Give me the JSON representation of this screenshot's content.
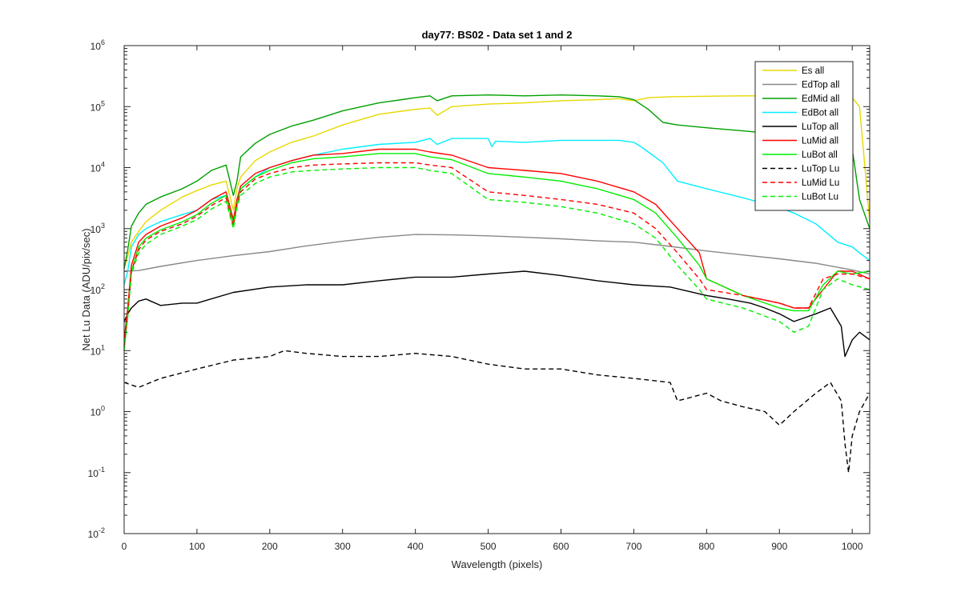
{
  "chart_data": {
    "type": "line",
    "title": "day77: BS02 - Data set 1 and 2",
    "xlabel": "Wavelength (pixels)",
    "ylabel": "Net Lu Data (ADU/pix/sec)",
    "xlim": [
      0,
      1024
    ],
    "ylim": [
      0.01,
      1000000
    ],
    "yscale": "log",
    "grid": false,
    "legend_position": "top-right",
    "x_ticks": [
      0,
      100,
      200,
      300,
      400,
      500,
      600,
      700,
      800,
      900,
      1000
    ],
    "x_tick_labels": [
      "0",
      "100",
      "200",
      "300",
      "400",
      "500",
      "600",
      "700",
      "800",
      "900",
      "1000"
    ],
    "y_ticks": [
      {
        "value": 0.01,
        "base": "10",
        "exp": "-2"
      },
      {
        "value": 0.1,
        "base": "10",
        "exp": "-1"
      },
      {
        "value": 1,
        "base": "10",
        "exp": "0"
      },
      {
        "value": 10,
        "base": "10",
        "exp": "1"
      },
      {
        "value": 100,
        "base": "10",
        "exp": "2"
      },
      {
        "value": 1000,
        "base": "10",
        "exp": "3"
      },
      {
        "value": 10000,
        "base": "10",
        "exp": "4"
      },
      {
        "value": 100000,
        "base": "10",
        "exp": "5"
      },
      {
        "value": 1000000,
        "base": "10",
        "exp": "6"
      }
    ],
    "series": [
      {
        "name": "Es  all",
        "color": "#e8d800",
        "dash": "solid",
        "x": [
          0,
          5,
          10,
          20,
          30,
          50,
          80,
          100,
          120,
          140,
          150,
          155,
          160,
          180,
          200,
          230,
          260,
          300,
          350,
          400,
          420,
          430,
          450,
          500,
          550,
          600,
          650,
          680,
          700,
          720,
          750,
          800,
          850,
          900,
          950,
          980,
          1000,
          1010,
          1024
        ],
        "y": [
          220,
          350,
          600,
          900,
          1300,
          2000,
          3300,
          4200,
          5200,
          6000,
          2000,
          4500,
          7000,
          13000,
          18000,
          26000,
          33000,
          50000,
          75000,
          90000,
          95000,
          72000,
          100000,
          110000,
          115000,
          125000,
          130000,
          135000,
          125000,
          140000,
          145000,
          148000,
          150000,
          150000,
          150000,
          148000,
          140000,
          100000,
          1300
        ]
      },
      {
        "name": "EdTop  all",
        "color": "#888888",
        "dash": "solid",
        "x": [
          0,
          20,
          50,
          100,
          150,
          200,
          250,
          300,
          350,
          400,
          450,
          500,
          550,
          600,
          650,
          700,
          750,
          800,
          850,
          900,
          950,
          1000,
          1024
        ],
        "y": [
          200,
          205,
          240,
          300,
          360,
          420,
          520,
          620,
          720,
          800,
          790,
          760,
          720,
          680,
          630,
          600,
          510,
          430,
          370,
          320,
          270,
          210,
          180
        ]
      },
      {
        "name": "EdMid  all",
        "color": "#00a000",
        "dash": "solid",
        "x": [
          0,
          5,
          10,
          20,
          30,
          50,
          80,
          100,
          120,
          140,
          150,
          155,
          160,
          180,
          200,
          230,
          260,
          300,
          350,
          400,
          420,
          430,
          450,
          500,
          550,
          600,
          650,
          680,
          700,
          720,
          740,
          760,
          800,
          850,
          900,
          950,
          980,
          1000,
          1010,
          1024
        ],
        "y": [
          220,
          450,
          1100,
          1800,
          2500,
          3300,
          4500,
          6000,
          9000,
          11000,
          3500,
          6000,
          15000,
          25000,
          35000,
          48000,
          60000,
          85000,
          115000,
          140000,
          150000,
          125000,
          150000,
          155000,
          150000,
          155000,
          150000,
          145000,
          130000,
          90000,
          55000,
          50000,
          45000,
          40000,
          35000,
          30000,
          25000,
          20000,
          3000,
          1000
        ]
      },
      {
        "name": "EdBot  all",
        "color": "#00eeff",
        "dash": "solid",
        "x": [
          0,
          5,
          10,
          20,
          30,
          50,
          80,
          100,
          120,
          140,
          150,
          155,
          160,
          180,
          200,
          230,
          260,
          300,
          350,
          400,
          420,
          430,
          450,
          500,
          505,
          510,
          550,
          600,
          650,
          680,
          700,
          710,
          720,
          740,
          760,
          800,
          850,
          900,
          920,
          950,
          980,
          1000,
          1010,
          1024
        ],
        "y": [
          120,
          200,
          500,
          800,
          1000,
          1300,
          1700,
          2000,
          3000,
          3500,
          1300,
          2500,
          4500,
          7000,
          10000,
          13000,
          16000,
          20000,
          24000,
          26000,
          30000,
          24000,
          30000,
          30000,
          22000,
          27000,
          26000,
          28000,
          28000,
          28000,
          26000,
          22000,
          18000,
          12000,
          6000,
          4500,
          3200,
          2200,
          1800,
          1200,
          600,
          500,
          400,
          300
        ]
      },
      {
        "name": "LuTop  all",
        "color": "#000000",
        "dash": "solid",
        "x": [
          0,
          5,
          10,
          20,
          30,
          50,
          80,
          100,
          150,
          200,
          250,
          300,
          350,
          400,
          450,
          500,
          550,
          600,
          650,
          700,
          750,
          800,
          830,
          860,
          880,
          900,
          920,
          950,
          970,
          985,
          990,
          1000,
          1010,
          1024
        ],
        "y": [
          30,
          40,
          50,
          65,
          70,
          55,
          60,
          60,
          90,
          110,
          120,
          120,
          140,
          160,
          160,
          180,
          200,
          170,
          140,
          120,
          110,
          80,
          70,
          60,
          50,
          40,
          30,
          40,
          50,
          25,
          8,
          15,
          20,
          15
        ]
      },
      {
        "name": "LuMid  all",
        "color": "#ff0000",
        "dash": "solid",
        "x": [
          0,
          5,
          10,
          20,
          30,
          50,
          80,
          100,
          120,
          140,
          150,
          155,
          160,
          180,
          200,
          230,
          260,
          300,
          350,
          400,
          420,
          450,
          500,
          550,
          600,
          650,
          700,
          730,
          760,
          790,
          800,
          850,
          900,
          920,
          940,
          960,
          980,
          1000,
          1024
        ],
        "y": [
          15,
          50,
          250,
          600,
          800,
          1100,
          1500,
          2000,
          3000,
          4000,
          1400,
          3000,
          5000,
          8000,
          10000,
          13000,
          16000,
          17000,
          20000,
          20000,
          18000,
          16000,
          10000,
          9000,
          8000,
          6000,
          4000,
          2500,
          1000,
          400,
          150,
          80,
          60,
          50,
          50,
          100,
          200,
          200,
          150
        ]
      },
      {
        "name": "LuBot  all",
        "color": "#00ee00",
        "dash": "solid",
        "x": [
          0,
          5,
          10,
          20,
          30,
          50,
          80,
          100,
          120,
          140,
          150,
          155,
          160,
          180,
          200,
          230,
          260,
          300,
          350,
          400,
          420,
          450,
          500,
          550,
          600,
          650,
          700,
          730,
          760,
          790,
          800,
          850,
          900,
          920,
          940,
          960,
          980,
          1000,
          1024
        ],
        "y": [
          10,
          40,
          200,
          500,
          700,
          950,
          1300,
          1700,
          2600,
          3500,
          1200,
          2600,
          4500,
          7000,
          9000,
          12000,
          14000,
          15000,
          17000,
          17000,
          15000,
          13500,
          8000,
          7000,
          6000,
          4500,
          3000,
          1800,
          700,
          250,
          150,
          80,
          50,
          45,
          45,
          120,
          200,
          180,
          200
        ]
      },
      {
        "name": "LuTop  Lu",
        "color": "#000000",
        "dash": "dashed",
        "x": [
          0,
          20,
          50,
          100,
          150,
          200,
          220,
          250,
          300,
          350,
          400,
          450,
          500,
          550,
          600,
          650,
          700,
          750,
          760,
          800,
          820,
          850,
          880,
          900,
          920,
          950,
          970,
          985,
          990,
          995,
          1000,
          1010,
          1024
        ],
        "y": [
          3,
          2.5,
          3.5,
          5,
          7,
          8,
          10,
          9,
          8,
          8,
          9,
          8,
          6,
          5,
          5,
          4,
          3.5,
          3,
          1.5,
          2,
          1.5,
          1.2,
          1,
          0.6,
          1,
          2,
          3,
          1.5,
          0.3,
          0.1,
          0.4,
          1,
          2
        ]
      },
      {
        "name": "LuMid  Lu",
        "color": "#ff0000",
        "dash": "dashed",
        "x": [
          0,
          5,
          10,
          20,
          30,
          50,
          80,
          100,
          120,
          140,
          150,
          155,
          160,
          180,
          200,
          230,
          260,
          300,
          350,
          400,
          420,
          450,
          500,
          550,
          600,
          650,
          700,
          730,
          760,
          790,
          800,
          850,
          900,
          920,
          940,
          960,
          980,
          1000,
          1024
        ],
        "y": [
          12,
          40,
          200,
          450,
          650,
          900,
          1200,
          1600,
          2400,
          3200,
          1100,
          2500,
          4000,
          6500,
          8000,
          10000,
          11000,
          11500,
          12000,
          12000,
          11000,
          10000,
          4000,
          3500,
          3000,
          2500,
          1800,
          1000,
          400,
          150,
          100,
          80,
          60,
          50,
          50,
          150,
          180,
          180,
          150
        ]
      },
      {
        "name": "LuBot  Lu",
        "color": "#00ee00",
        "dash": "dashed",
        "x": [
          0,
          5,
          10,
          20,
          30,
          50,
          80,
          100,
          120,
          140,
          150,
          155,
          160,
          180,
          200,
          230,
          260,
          300,
          350,
          400,
          420,
          450,
          500,
          550,
          600,
          650,
          700,
          730,
          760,
          790,
          800,
          850,
          900,
          920,
          940,
          960,
          980,
          1000,
          1024
        ],
        "y": [
          10,
          35,
          180,
          400,
          550,
          800,
          1100,
          1400,
          2100,
          2800,
          1000,
          2200,
          3500,
          5500,
          7000,
          8500,
          9000,
          9500,
          10000,
          10000,
          9000,
          8000,
          3000,
          2700,
          2300,
          1800,
          1200,
          700,
          250,
          100,
          70,
          50,
          30,
          20,
          25,
          100,
          150,
          120,
          100
        ]
      }
    ]
  }
}
